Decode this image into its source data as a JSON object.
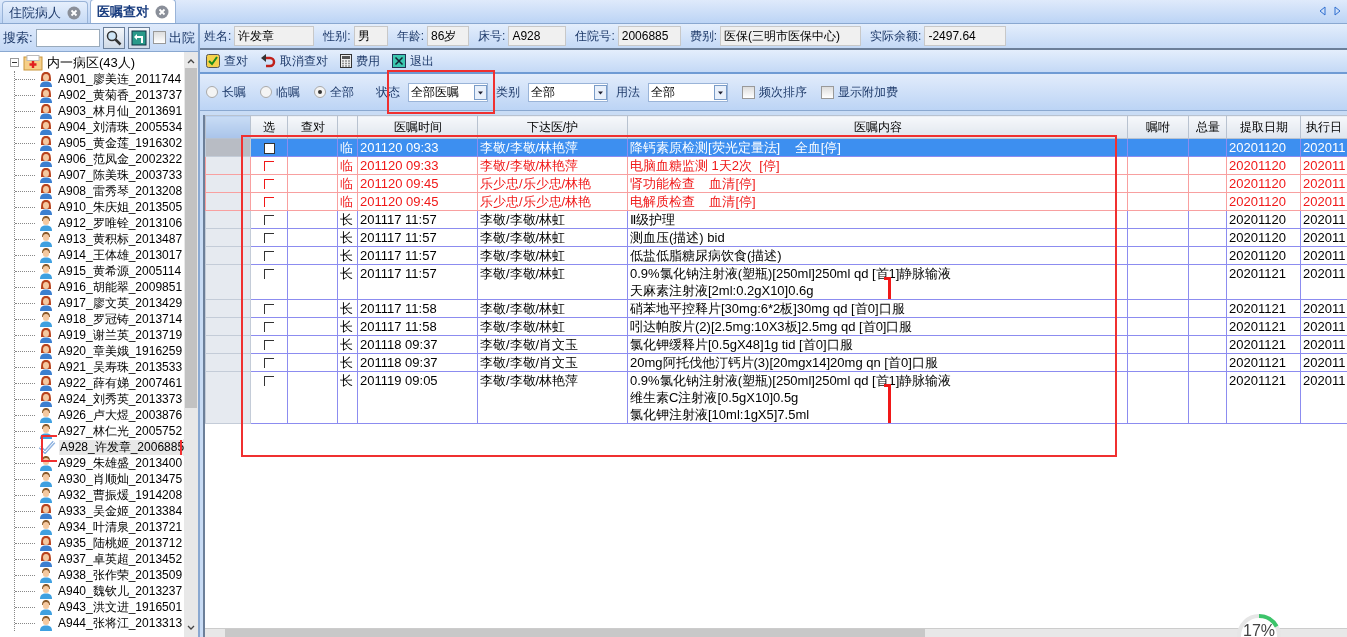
{
  "tabs": [
    {
      "label": "住院病人",
      "selected": false
    },
    {
      "label": "医嘱查对",
      "selected": true
    }
  ],
  "search": {
    "label": "搜索:",
    "discharged_label": "出院",
    "discharged_checked": false
  },
  "tree": {
    "label": "内一病区(43人)",
    "expanded": true,
    "children": [
      {
        "label": "A901_廖美连_2011744",
        "kind": "female",
        "selected": false
      },
      {
        "label": "A902_黄菊香_2013737",
        "kind": "female",
        "selected": false
      },
      {
        "label": "A903_林月仙_2013691",
        "kind": "female",
        "selected": false
      },
      {
        "label": "A904_刘清珠_2005534",
        "kind": "female",
        "selected": false
      },
      {
        "label": "A905_黄金莲_1916302",
        "kind": "female",
        "selected": false
      },
      {
        "label": "A906_范凤金_2002322",
        "kind": "female",
        "selected": false
      },
      {
        "label": "A907_陈美珠_2003733",
        "kind": "female",
        "selected": false
      },
      {
        "label": "A908_雷秀琴_2013208",
        "kind": "female",
        "selected": false
      },
      {
        "label": "A910_朱庆姐_2013505",
        "kind": "female",
        "selected": false
      },
      {
        "label": "A912_罗唯铨_2013106",
        "kind": "male",
        "selected": false
      },
      {
        "label": "A913_黄积标_2013487",
        "kind": "male",
        "selected": false
      },
      {
        "label": "A914_王体雄_2013017",
        "kind": "male",
        "selected": false
      },
      {
        "label": "A915_黄希源_2005114",
        "kind": "male",
        "selected": false
      },
      {
        "label": "A916_胡能翠_2009851",
        "kind": "female",
        "selected": false
      },
      {
        "label": "A917_廖文英_2013429",
        "kind": "female",
        "selected": false
      },
      {
        "label": "A918_罗冠铸_2013714",
        "kind": "male",
        "selected": false
      },
      {
        "label": "A919_谢兰英_2013719",
        "kind": "female",
        "selected": false
      },
      {
        "label": "A920_章美娥_1916259",
        "kind": "female",
        "selected": false
      },
      {
        "label": "A921_吴寿珠_2013533",
        "kind": "female",
        "selected": false
      },
      {
        "label": "A922_薛有娣_2007461",
        "kind": "female",
        "selected": false
      },
      {
        "label": "A924_刘秀英_2013373",
        "kind": "female",
        "selected": false
      },
      {
        "label": "A926_卢大煜_2003876",
        "kind": "male",
        "selected": false
      },
      {
        "label": "A927_林仁光_2005752",
        "kind": "male",
        "selected": false
      },
      {
        "label": "A928_许发章_2006885",
        "selected": true
      },
      {
        "label": "A929_朱雄盛_2013400",
        "kind": "male",
        "selected": false
      },
      {
        "label": "A930_肖顺灿_2013475",
        "kind": "male",
        "selected": false
      },
      {
        "label": "A932_曹振煖_1914208",
        "kind": "male",
        "selected": false
      },
      {
        "label": "A933_吴金姬_2013384",
        "kind": "female",
        "selected": false
      },
      {
        "label": "A934_叶清泉_2013721",
        "kind": "male",
        "selected": false
      },
      {
        "label": "A935_陆桃姬_2013712",
        "kind": "female",
        "selected": false
      },
      {
        "label": "A937_卓英超_2013452",
        "kind": "female",
        "selected": false
      },
      {
        "label": "A938_张作荣_2013509",
        "kind": "male",
        "selected": false
      },
      {
        "label": "A940_魏钦儿_2013237",
        "kind": "male",
        "selected": false
      },
      {
        "label": "A943_洪文进_1916501",
        "kind": "male",
        "selected": false
      },
      {
        "label": "A944_张将江_2013313",
        "kind": "male",
        "selected": false
      }
    ]
  },
  "patient": [
    {
      "label": "姓名:",
      "value": "许发章"
    },
    {
      "label": "性别:",
      "value": "男"
    },
    {
      "label": "年龄:",
      "value": "86岁"
    },
    {
      "label": "床号:",
      "value": "A928"
    },
    {
      "label": "住院号:",
      "value": "2006885"
    },
    {
      "label": "费别:",
      "value": "医保(三明市医保中心)"
    },
    {
      "label": "实际余额:",
      "value": "-2497.64"
    }
  ],
  "toolbar": [
    {
      "label": "查对",
      "kind": "check"
    },
    {
      "label": "取消查对",
      "kind": "undo"
    },
    {
      "label": "费用",
      "kind": "calculator"
    },
    {
      "label": "退出",
      "kind": "exit"
    }
  ],
  "filters": {
    "order_types": [
      {
        "label": "长嘱",
        "selected": false
      },
      {
        "label": "临嘱",
        "selected": false
      },
      {
        "label": "全部",
        "selected": true
      }
    ],
    "dropdowns": [
      {
        "label": "状态",
        "value": "全部医嘱"
      },
      {
        "label": "类别",
        "value": "全部"
      },
      {
        "label": "用法",
        "value": "全部"
      }
    ],
    "options": [
      {
        "label": "频次排序",
        "checked": false
      },
      {
        "label": "显示附加费",
        "checked": false
      }
    ]
  },
  "table": {
    "columns": [
      "选",
      "查对",
      "医嘱时间",
      "下达医/护",
      "医嘱内容",
      "嘱咐",
      "总量",
      "提取日期",
      "执行日"
    ],
    "rows": [
      {
        "selected": true,
        "stopped": false,
        "type": "临",
        "time": "201120 09:33",
        "staff": "李敬/李敬/林艳萍",
        "content": [
          "降钙素原检测[荧光定量法]    全血[停]"
        ],
        "grouped": false,
        "extract_date": "20201120",
        "exec_date": "202011"
      },
      {
        "selected": false,
        "stopped": true,
        "type": "临",
        "time": "201120 09:33",
        "staff": "李敬/李敬/林艳萍",
        "content": [
          "电脑血糖监测 1天2次  [停]"
        ],
        "grouped": false,
        "extract_date": "20201120",
        "exec_date": "202011"
      },
      {
        "selected": false,
        "stopped": true,
        "type": "临",
        "time": "201120 09:45",
        "staff": "乐少忠/乐少忠/林艳",
        "content": [
          "肾功能检查    血清[停]"
        ],
        "grouped": false,
        "extract_date": "20201120",
        "exec_date": "202011"
      },
      {
        "selected": false,
        "stopped": true,
        "type": "临",
        "time": "201120 09:45",
        "staff": "乐少忠/乐少忠/林艳",
        "content": [
          "电解质检查    血清[停]"
        ],
        "grouped": false,
        "extract_date": "20201120",
        "exec_date": "202011"
      },
      {
        "selected": false,
        "stopped": false,
        "type": "长",
        "time": "201117 11:57",
        "staff": "李敬/李敬/林虹",
        "content": [
          "Ⅱ级护理"
        ],
        "grouped": false,
        "extract_date": "20201120",
        "exec_date": "202011"
      },
      {
        "selected": false,
        "stopped": false,
        "type": "长",
        "time": "201117 11:57",
        "staff": "李敬/李敬/林虹",
        "content": [
          "测血压(描述) bid"
        ],
        "grouped": false,
        "extract_date": "20201120",
        "exec_date": "202011"
      },
      {
        "selected": false,
        "stopped": false,
        "type": "长",
        "time": "201117 11:57",
        "staff": "李敬/李敬/林虹",
        "content": [
          "低盐低脂糖尿病饮食(描述)"
        ],
        "grouped": false,
        "extract_date": "20201120",
        "exec_date": "202011"
      },
      {
        "selected": false,
        "stopped": false,
        "type": "长",
        "time": "201117 11:57",
        "staff": "李敬/李敬/林虹",
        "content": [
          "0.9%氯化钠注射液(塑瓶)[250ml]250ml qd [首1]静脉输液",
          "天麻素注射液[2ml:0.2gX10]0.6g"
        ],
        "grouped": true,
        "extract_date": "20201121",
        "exec_date": "202011"
      },
      {
        "selected": false,
        "stopped": false,
        "type": "长",
        "time": "201117 11:58",
        "staff": "李敬/李敬/林虹",
        "content": [
          "硝苯地平控释片[30mg:6*2板]30mg qd [首0]口服"
        ],
        "grouped": false,
        "extract_date": "20201121",
        "exec_date": "202011"
      },
      {
        "selected": false,
        "stopped": false,
        "type": "长",
        "time": "201117 11:58",
        "staff": "李敬/李敬/林虹",
        "content": [
          "吲达帕胺片(2)[2.5mg:10X3板]2.5mg qd [首0]口服"
        ],
        "grouped": false,
        "extract_date": "20201121",
        "exec_date": "202011"
      },
      {
        "selected": false,
        "stopped": false,
        "type": "长",
        "time": "201118 09:37",
        "staff": "李敬/李敬/肖文玉",
        "content": [
          "氯化钾缓释片[0.5gX48]1g tid [首0]口服"
        ],
        "grouped": false,
        "extract_date": "20201121",
        "exec_date": "202011"
      },
      {
        "selected": false,
        "stopped": false,
        "type": "长",
        "time": "201118 09:37",
        "staff": "李敬/李敬/肖文玉",
        "content": [
          "20mg阿托伐他汀钙片(3)[20mgx14]20mg qn [首0]口服"
        ],
        "grouped": false,
        "extract_date": "20201121",
        "exec_date": "202011"
      },
      {
        "selected": false,
        "stopped": false,
        "type": "长",
        "time": "201119 09:05",
        "staff": "李敬/李敬/林艳萍",
        "content": [
          "0.9%氯化钠注射液(塑瓶)[250ml]250ml qd [首1]静脉输液",
          "维生素C注射液[0.5gX10]0.5g",
          "氯化钾注射液[10ml:1gX5]7.5ml"
        ],
        "grouped": true,
        "extract_date": "20201121",
        "exec_date": "202011"
      }
    ]
  },
  "progress": {
    "label": "17%",
    "level": 0.17
  }
}
